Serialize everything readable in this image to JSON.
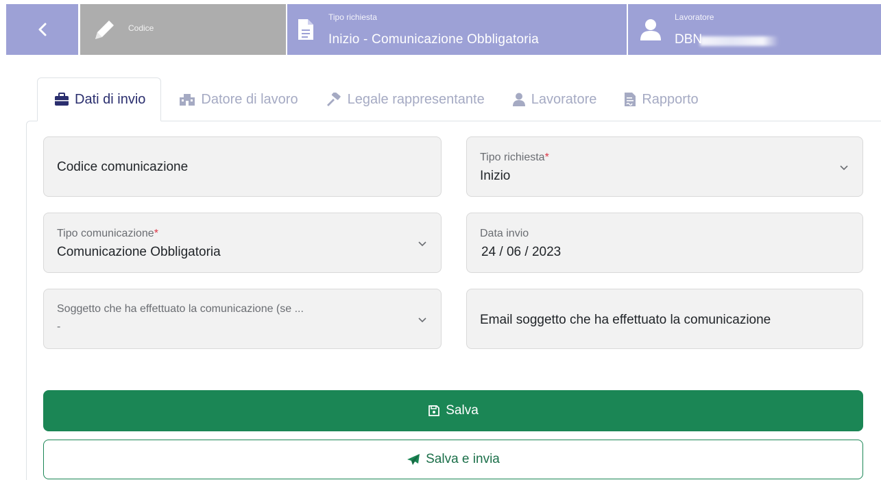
{
  "header": {
    "codice_label": "Codice",
    "tipo_richiesta_label": "Tipo richiesta",
    "tipo_richiesta_value": "Inizio - Comunicazione Obbligatoria",
    "lavoratore_label": "Lavoratore",
    "lavoratore_value": "DBN"
  },
  "tabs": [
    {
      "label": "Dati di invio",
      "icon": "briefcase-icon",
      "active": true
    },
    {
      "label": "Datore di lavoro",
      "icon": "building-icon",
      "active": false
    },
    {
      "label": "Legale rappresentante",
      "icon": "gavel-icon",
      "active": false
    },
    {
      "label": "Lavoratore",
      "icon": "user-icon",
      "active": false
    },
    {
      "label": "Rapporto",
      "icon": "file-contract-icon",
      "active": false
    }
  ],
  "form": {
    "codice_comunicazione": {
      "placeholder": "Codice comunicazione"
    },
    "tipo_richiesta": {
      "label": "Tipo richiesta",
      "required_mark": "*",
      "value": "Inizio"
    },
    "tipo_comunicazione": {
      "label": "Tipo comunicazione",
      "required_mark": "*",
      "value": "Comunicazione Obbligatoria"
    },
    "data_invio": {
      "label": "Data invio",
      "value": "24 / 06 / 2023"
    },
    "soggetto": {
      "label": "Soggetto che ha effettuato la comunicazione (se ...",
      "value": "-"
    },
    "email_soggetto": {
      "placeholder": "Email soggetto che ha effettuato la comunicazione"
    }
  },
  "buttons": {
    "salva": "Salva",
    "salva_invia": "Salva e invia"
  },
  "colors": {
    "header_accent": "#9da1d6",
    "header_disabled": "#adadad",
    "primary_green": "#1b8655",
    "active_tab_text": "#2a2e6e",
    "required": "#dc3545"
  }
}
